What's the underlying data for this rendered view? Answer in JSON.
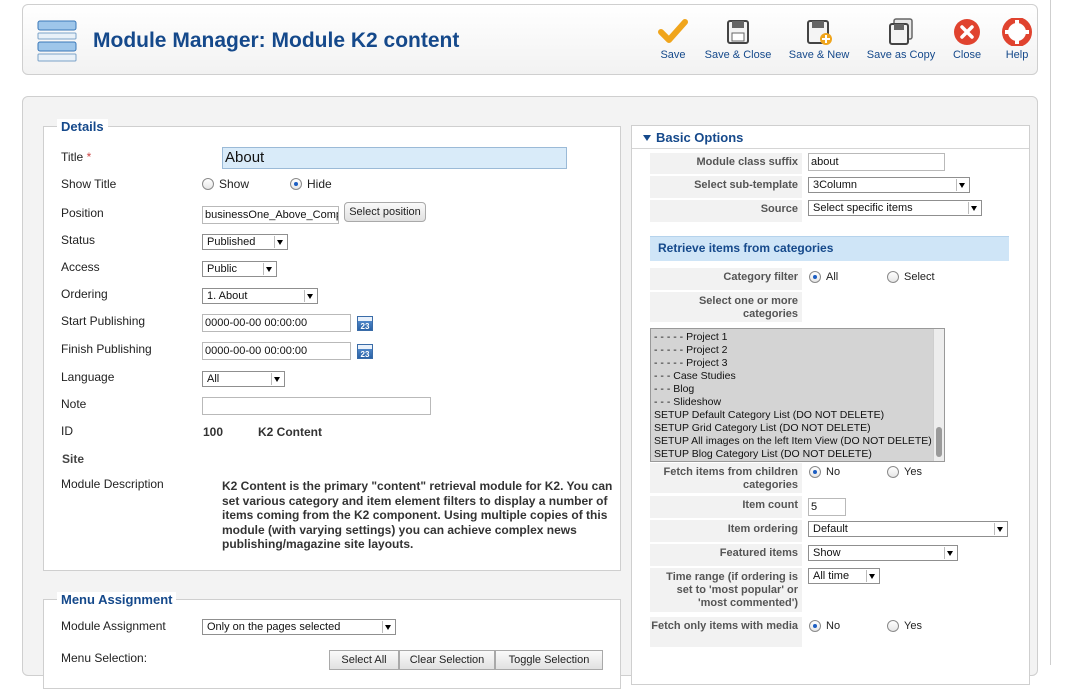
{
  "header": {
    "title": "Module Manager: Module K2 content",
    "buttons": [
      {
        "label": "Save",
        "icon": "check-icon"
      },
      {
        "label": "Save & Close",
        "icon": "save-close-icon"
      },
      {
        "label": "Save & New",
        "icon": "save-new-icon"
      },
      {
        "label": "Save as Copy",
        "icon": "save-copy-icon"
      },
      {
        "label": "Close",
        "icon": "close-icon"
      },
      {
        "label": "Help",
        "icon": "help-lifebuoy-icon"
      }
    ],
    "colors": {
      "title": "#15498b",
      "save": "#f0a51c",
      "close": "#e0432f"
    }
  },
  "details": {
    "legend": "Details",
    "title_label": "Title",
    "required_mark": "*",
    "title_value": "About",
    "show_title_label": "Show Title",
    "show_title_options": [
      "Show",
      "Hide"
    ],
    "show_title_selected": "Hide",
    "position_label": "Position",
    "position_value": "businessOne_Above_Component",
    "select_position_label": "Select position",
    "status_label": "Status",
    "status_value": "Published",
    "access_label": "Access",
    "access_value": "Public",
    "ordering_label": "Ordering",
    "ordering_value": "1. About",
    "start_label": "Start Publishing",
    "start_value": "0000-00-00 00:00:00",
    "finish_label": "Finish Publishing",
    "finish_value": "0000-00-00 00:00:00",
    "calendar_day": "23",
    "language_label": "Language",
    "language_value": "All",
    "note_label": "Note",
    "note_value": "",
    "id_label": "ID",
    "id_value": "100",
    "module_type": "K2 Content",
    "site_label": "Site",
    "desc_label": "Module Description",
    "desc_value": "K2 Content is the primary \"content\" retrieval module for K2. You can set various category and item element filters to display a number of items coming from the K2 component. Using multiple copies of this module (with varying settings) you can achieve complex news publishing/magazine site layouts."
  },
  "menu": {
    "legend": "Menu Assignment",
    "assignment_label": "Module Assignment",
    "assignment_value": "Only on the pages selected",
    "selection_label": "Menu Selection:",
    "select_all": "Select All",
    "clear_selection": "Clear Selection",
    "toggle_selection": "Toggle Selection"
  },
  "basic": {
    "title": "Basic Options",
    "class_suffix_label": "Module class suffix",
    "class_suffix_value": "about",
    "subtemplate_label": "Select sub-template",
    "subtemplate_value": "3Column",
    "source_label": "Source",
    "source_value": "Select specific items",
    "retrieve_head": "Retrieve items from categories",
    "category_filter_label": "Category filter",
    "category_filter_options": [
      "All",
      "Select"
    ],
    "category_filter_selected": "All",
    "select_categories_label": "Select one or more categories",
    "categories": [
      "- - - - - Project 1",
      "- - - - - Project 2",
      "- - - - - Project 3",
      "- - - Case Studies",
      "- - - Blog",
      "- - - Slideshow",
      "SETUP Default Category List (DO NOT DELETE)",
      "SETUP Grid Category List (DO NOT DELETE)",
      "SETUP All images on the left Item View (DO NOT DELETE)",
      "SETUP Blog Category List (DO NOT DELETE)"
    ],
    "fetch_children_label": "Fetch items from children categories",
    "fetch_children_options": [
      "No",
      "Yes"
    ],
    "fetch_children_selected": "No",
    "item_count_label": "Item count",
    "item_count_value": "5",
    "item_ordering_label": "Item ordering",
    "item_ordering_value": "Default",
    "featured_label": "Featured items",
    "featured_value": "Show",
    "time_range_label": "Time range (if ordering is set to 'most popular' or 'most commented')",
    "time_range_value": "All time",
    "media_label": "Fetch only items with media",
    "media_options": [
      "No",
      "Yes"
    ],
    "media_selected": "No"
  }
}
